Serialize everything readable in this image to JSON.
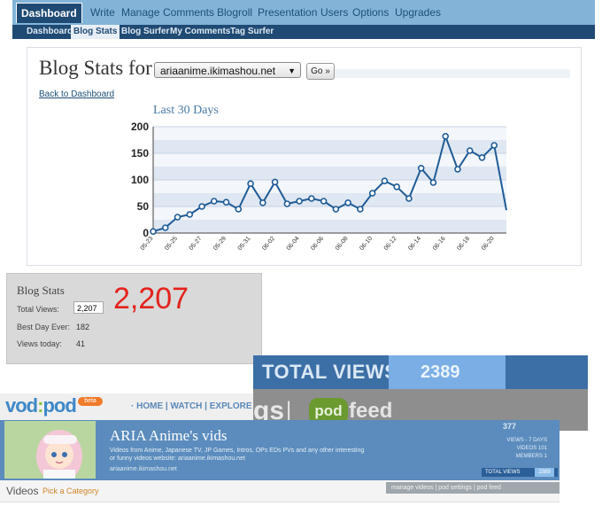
{
  "topnav": {
    "items": [
      "Dashboard",
      "Write",
      "Manage",
      "Comments",
      "Blogroll",
      "Presentation",
      "Users",
      "Options",
      "Upgrades"
    ]
  },
  "subnav": {
    "items": [
      "Dashboard",
      "Blog Stats",
      "Blog Surfer",
      "My Comments",
      "Tag Surfer"
    ]
  },
  "stats_page": {
    "title": "Blog Stats for",
    "blog_selected": "ariaanime.ikimashou.net",
    "go_label": "Go »",
    "back_link": "Back to Dashboard",
    "chart_heading": "Last 30 Days"
  },
  "chart_data": {
    "type": "line",
    "x": [
      "05-23",
      "05-24",
      "05-25",
      "05-26",
      "05-27",
      "05-28",
      "05-29",
      "05-30",
      "05-31",
      "06-01",
      "06-02",
      "06-03",
      "06-04",
      "06-05",
      "06-06",
      "06-07",
      "06-08",
      "06-09",
      "06-10",
      "06-11",
      "06-12",
      "06-13",
      "06-14",
      "06-15",
      "06-16",
      "06-17",
      "06-18",
      "06-19",
      "06-20",
      "06-21"
    ],
    "tick_labels": [
      "05-23",
      "05-25",
      "05-27",
      "05-29",
      "05-31",
      "06-02",
      "06-04",
      "06-06",
      "06-08",
      "06-10",
      "06-12",
      "06-14",
      "06-16",
      "06-18",
      "06-20"
    ],
    "values": [
      3,
      10,
      30,
      35,
      50,
      60,
      58,
      45,
      93,
      57,
      96,
      55,
      60,
      65,
      60,
      45,
      57,
      45,
      75,
      98,
      87,
      65,
      122,
      95,
      182,
      120,
      155,
      142,
      165,
      43
    ],
    "ylim": [
      0,
      200
    ],
    "yticks": [
      0,
      50,
      100,
      150,
      200
    ],
    "grid": true,
    "line_color": "#1f5c96"
  },
  "blog_stats_panel": {
    "title": "Blog Stats",
    "total_views_label": "Total Views:",
    "total_views_value": "2,207",
    "best_day_label": "Best Day Ever:",
    "best_day_value": "182",
    "views_today_label": "Views today:",
    "views_today_value": "41",
    "big_number": "2,207",
    "big_number_color": "#e3221c"
  },
  "total_views_banner": {
    "label": "TOTAL VIEWS",
    "value": "2389"
  },
  "vodpod": {
    "logo_left": "vod",
    "logo_colon": ":",
    "logo_right": "pod",
    "beta": "beta",
    "nav": "· HOME | WATCH | EXPLORE",
    "overlay_text_left": "gs",
    "overlay_pipe": "|",
    "pod_logo": "pod",
    "feed": "feed",
    "vids_title": "ARIA Anime's vids",
    "description": "Videos from Anime, Japanese TV, JP Games, Intros, OPs EDs PVs and any other interesting or funny videos website: ariaanime.ikimashou.net",
    "url": "ariaanime.ikimashou.net",
    "top_count": "377",
    "side_stats": [
      {
        "label": "VIEWS - 7 DAYS",
        "value": ""
      },
      {
        "label": "VIDEOS",
        "value": "101"
      },
      {
        "label": "MEMBERS",
        "value": "1"
      }
    ],
    "tv_small_label": "TOTAL VIEWS",
    "tv_small_value": "2389",
    "videos_label": "Videos",
    "pick_category": "Pick a Category",
    "manage_links": "manage videos | pod settings | pod feed"
  }
}
